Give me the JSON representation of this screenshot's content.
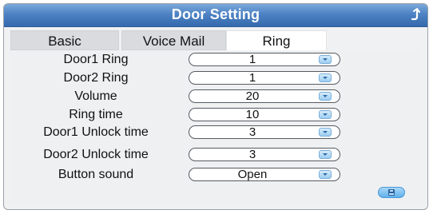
{
  "window": {
    "title": "Door Setting"
  },
  "tabs": [
    {
      "label": "Basic",
      "active": false
    },
    {
      "label": "Voice Mail",
      "active": false
    },
    {
      "label": "Ring",
      "active": true
    }
  ],
  "settings": [
    {
      "label": "Door1 Ring",
      "value": "1"
    },
    {
      "label": "Door2 Ring",
      "value": "1"
    },
    {
      "label": "Volume",
      "value": "20"
    },
    {
      "label": "Ring time",
      "value": "10"
    },
    {
      "label": "Door1 Unlock time",
      "value": "3"
    },
    {
      "label": "Door2 Unlock time",
      "value": "3"
    },
    {
      "label": "Button  sound",
      "value": "Open"
    }
  ],
  "icons": {
    "back": "back-arrow-icon",
    "dropdown": "chevron-down-icon",
    "save": "save-icon"
  },
  "colors": {
    "titlebar": "#4d83c4",
    "accent": "#5fb0ec"
  }
}
